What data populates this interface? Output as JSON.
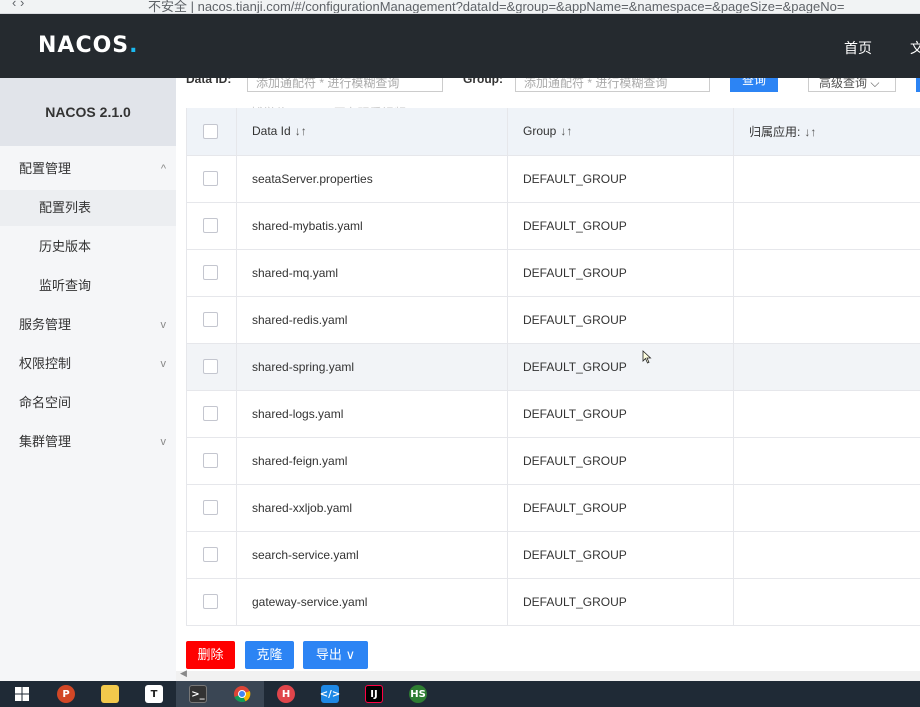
{
  "browser": {
    "nav_icons": "‹   ›",
    "url_text": "不安全 | nacos.tianji.com/#/configurationManagement?dataId=&group=&appName=&namespace=&pageSize=&pageNo="
  },
  "header": {
    "logo_text": "NACOS",
    "logo_dot": ".",
    "nav_home": "首页",
    "nav_docs": "文"
  },
  "sidebar": {
    "version": "NACOS 2.1.0",
    "items": [
      {
        "label": "配置管理",
        "chevron": "^"
      },
      {
        "label": "配置列表"
      },
      {
        "label": "历史版本"
      },
      {
        "label": "监听查询"
      },
      {
        "label": "服务管理",
        "chevron": "v"
      },
      {
        "label": "权限控制",
        "chevron": "v"
      },
      {
        "label": "命名空间"
      },
      {
        "label": "集群管理",
        "chevron": "v"
      }
    ]
  },
  "search": {
    "dataid_label": "Data ID:",
    "dataid_placeholder": "添加通配符 * 进行模糊查询",
    "group_label": "Group:",
    "group_placeholder": "添加通配符 * 进行模糊查询",
    "query_button": "查询",
    "advanced_button": "高级查询"
  },
  "watermark": "博学谷 887713 正在观看视频",
  "table": {
    "headers": [
      "Data Id",
      "Group",
      "归属应用:"
    ],
    "sort_glyph": "↓↑",
    "rows": [
      {
        "data_id": "seataServer.properties",
        "group": "DEFAULT_GROUP",
        "app": ""
      },
      {
        "data_id": "shared-mybatis.yaml",
        "group": "DEFAULT_GROUP",
        "app": ""
      },
      {
        "data_id": "shared-mq.yaml",
        "group": "DEFAULT_GROUP",
        "app": ""
      },
      {
        "data_id": "shared-redis.yaml",
        "group": "DEFAULT_GROUP",
        "app": ""
      },
      {
        "data_id": "shared-spring.yaml",
        "group": "DEFAULT_GROUP",
        "app": ""
      },
      {
        "data_id": "shared-logs.yaml",
        "group": "DEFAULT_GROUP",
        "app": ""
      },
      {
        "data_id": "shared-feign.yaml",
        "group": "DEFAULT_GROUP",
        "app": ""
      },
      {
        "data_id": "shared-xxljob.yaml",
        "group": "DEFAULT_GROUP",
        "app": ""
      },
      {
        "data_id": "search-service.yaml",
        "group": "DEFAULT_GROUP",
        "app": ""
      },
      {
        "data_id": "gateway-service.yaml",
        "group": "DEFAULT_GROUP",
        "app": ""
      }
    ]
  },
  "actions": {
    "delete": "删除",
    "clone": "克隆",
    "export": "导出"
  },
  "colors": {
    "header_bg": "#252a2f",
    "primary": "#2c84f4",
    "danger": "#ff0000",
    "logo_dot": "#1bb9f0"
  },
  "taskbar": {
    "icons": [
      "windows-start",
      "powerpoint",
      "file-explorer",
      "typora",
      "terminal",
      "chrome",
      "hbuilder",
      "vscode",
      "intellij-idea",
      "hs-tool"
    ]
  }
}
